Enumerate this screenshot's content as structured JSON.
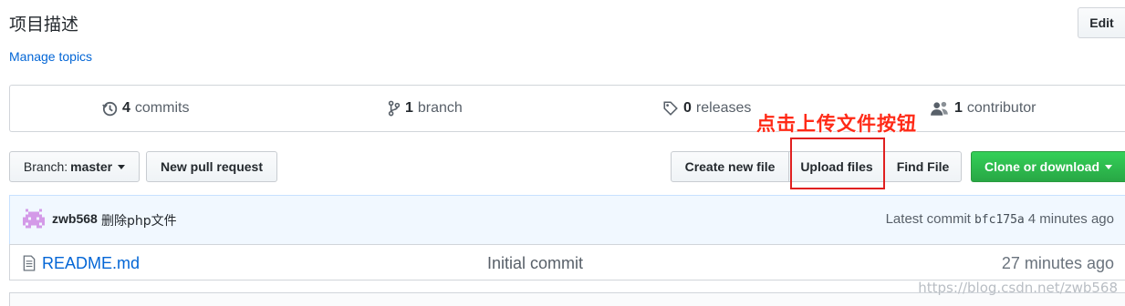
{
  "repo": {
    "description": "项目描述",
    "manage_topics": "Manage topics",
    "edit_label": "Edit"
  },
  "summary": {
    "commits": {
      "count": "4",
      "label": "commits",
      "icon": "history-icon"
    },
    "branches": {
      "count": "1",
      "label": "branch",
      "icon": "git-branch-icon"
    },
    "releases": {
      "count": "0",
      "label": "releases",
      "icon": "tag-icon"
    },
    "contributors": {
      "count": "1",
      "label": "contributor",
      "icon": "people-icon"
    }
  },
  "toolbar": {
    "branch_prefix": "Branch:",
    "branch_name": "master",
    "new_pull_request": "New pull request",
    "create_new_file": "Create new file",
    "upload_files": "Upload files",
    "find_file": "Find File",
    "clone_or_download": "Clone or download"
  },
  "annotation": {
    "text": "点击上传文件按钮",
    "color": "#ff2a17"
  },
  "latest_commit": {
    "author": "zwb568",
    "message": "删除php文件",
    "prefix": "Latest commit",
    "sha": "bfc175a",
    "age": "4 minutes ago"
  },
  "files": [
    {
      "name": "README.md",
      "message": "Initial commit",
      "age": "27 minutes ago",
      "icon": "file-text-icon"
    }
  ],
  "watermark": "https://blog.csdn.net/zwb568",
  "colors": {
    "link": "#0366d6",
    "clone_green": "#28a745"
  }
}
